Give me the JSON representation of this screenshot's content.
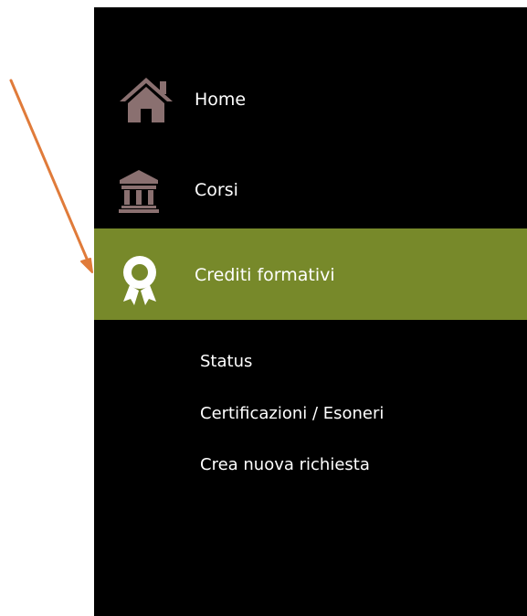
{
  "sidebar": {
    "items": [
      {
        "label": "Home",
        "icon": "home-icon"
      },
      {
        "label": "Corsi",
        "icon": "building-columns-icon"
      },
      {
        "label": "Crediti formativi",
        "icon": "award-ribbon-icon",
        "active": true
      }
    ],
    "submenu": [
      {
        "label": "Status"
      },
      {
        "label": "Certificazioni / Esoneri"
      },
      {
        "label": "Crea nuova richiesta"
      }
    ]
  },
  "colors": {
    "sidebar_bg": "#000000",
    "active_bg": "#77892a",
    "icon_color": "#8a7070",
    "active_icon_color": "#ffffff",
    "annotation_arrow": "#e07b3a",
    "text": "#ffffff"
  },
  "annotation": {
    "type": "arrow",
    "points_to": "sidebar-item-crediti-formativi"
  }
}
